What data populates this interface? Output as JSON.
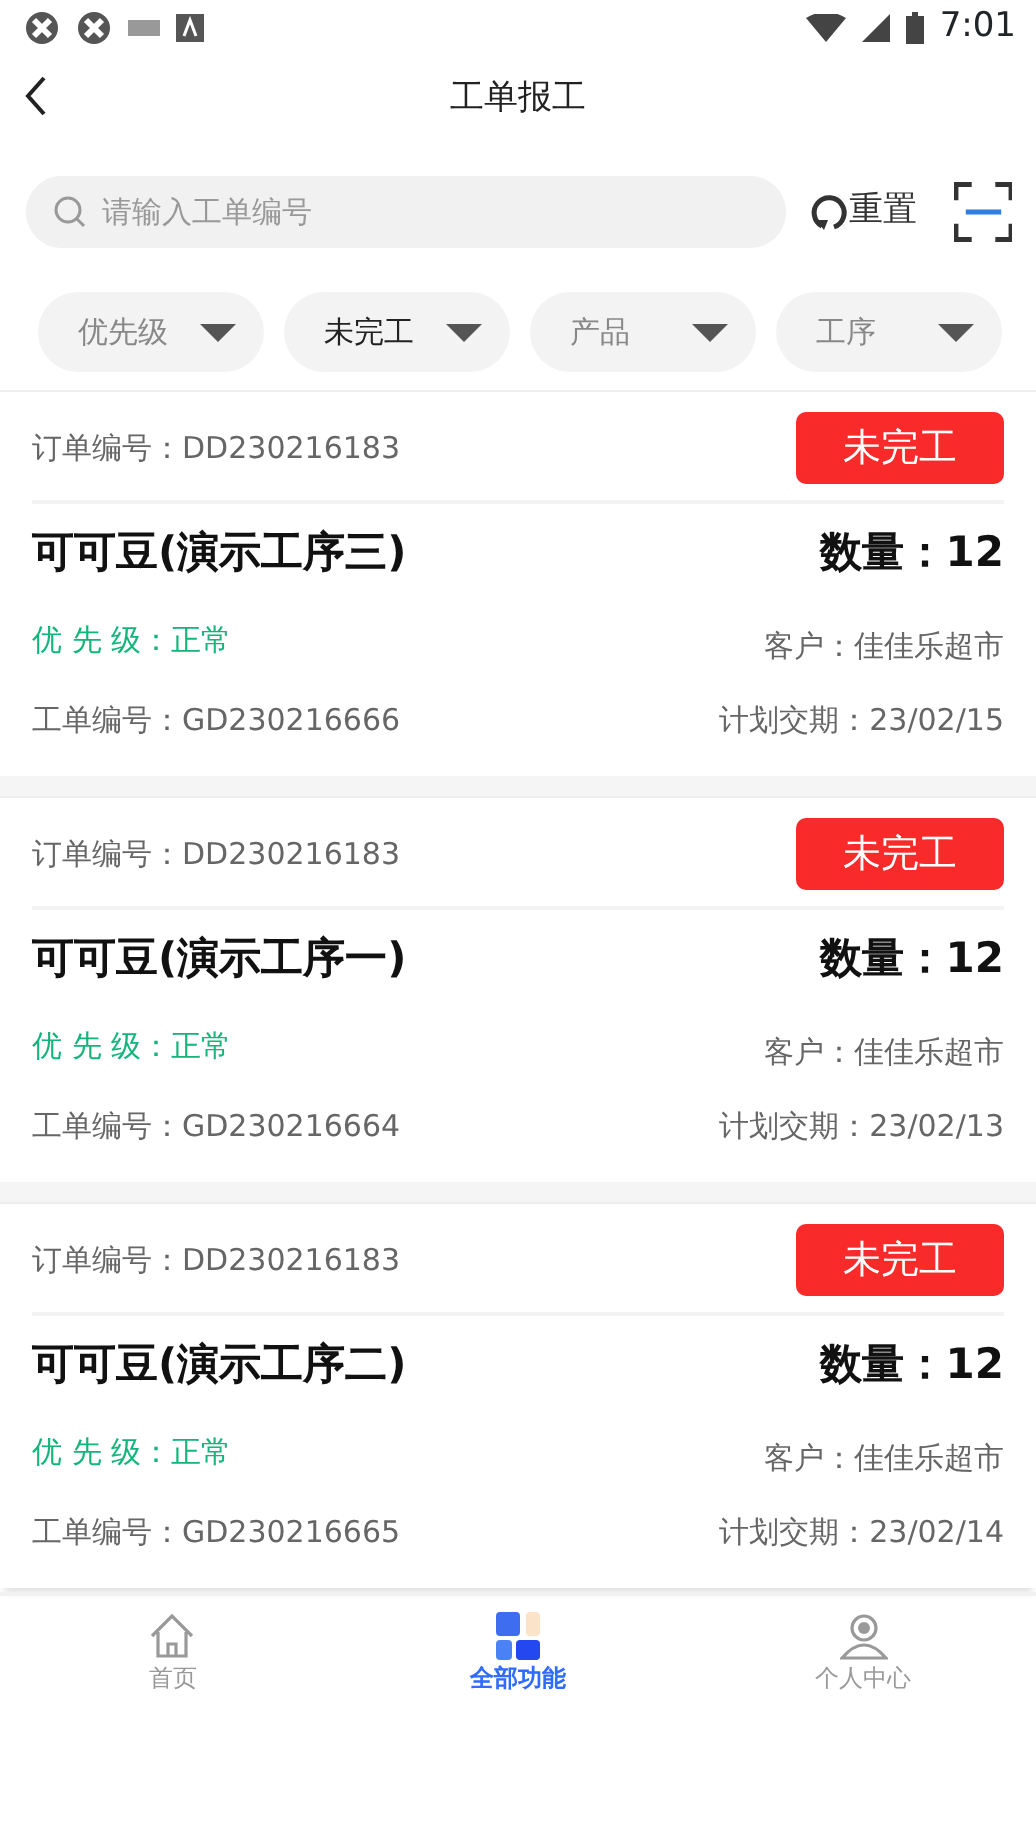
{
  "status_bar": {
    "time": "7:01"
  },
  "header": {
    "title": "工单报工"
  },
  "search": {
    "placeholder": "请输入工单编号",
    "reset_label": "重置"
  },
  "filters": [
    {
      "label": "优先级",
      "selected": false
    },
    {
      "label": "未完工",
      "selected": true
    },
    {
      "label": "产品",
      "selected": false
    },
    {
      "label": "工序",
      "selected": false
    }
  ],
  "orders": [
    {
      "order_no": "订单编号：DD230216183",
      "status": "未完工",
      "product": "可可豆(演示工序三)",
      "quantity": "数量：12",
      "priority": "优 先 级：正常",
      "customer": "客户：佳佳乐超市",
      "work_order_no": "工单编号：GD230216666",
      "due_date": "计划交期：23/02/15"
    },
    {
      "order_no": "订单编号：DD230216183",
      "status": "未完工",
      "product": "可可豆(演示工序一)",
      "quantity": "数量：12",
      "priority": "优 先 级：正常",
      "customer": "客户：佳佳乐超市",
      "work_order_no": "工单编号：GD230216664",
      "due_date": "计划交期：23/02/13"
    },
    {
      "order_no": "订单编号：DD230216183",
      "status": "未完工",
      "product": "可可豆(演示工序二)",
      "quantity": "数量：12",
      "priority": "优 先 级：正常",
      "customer": "客户：佳佳乐超市",
      "work_order_no": "工单编号：GD230216665",
      "due_date": "计划交期：23/02/14"
    }
  ],
  "tab_bar": [
    {
      "kind": "home",
      "label": "首页",
      "selected": false
    },
    {
      "kind": "apps",
      "label": "全部功能",
      "selected": true
    },
    {
      "kind": "profile",
      "label": "个人中心",
      "selected": false
    }
  ]
}
